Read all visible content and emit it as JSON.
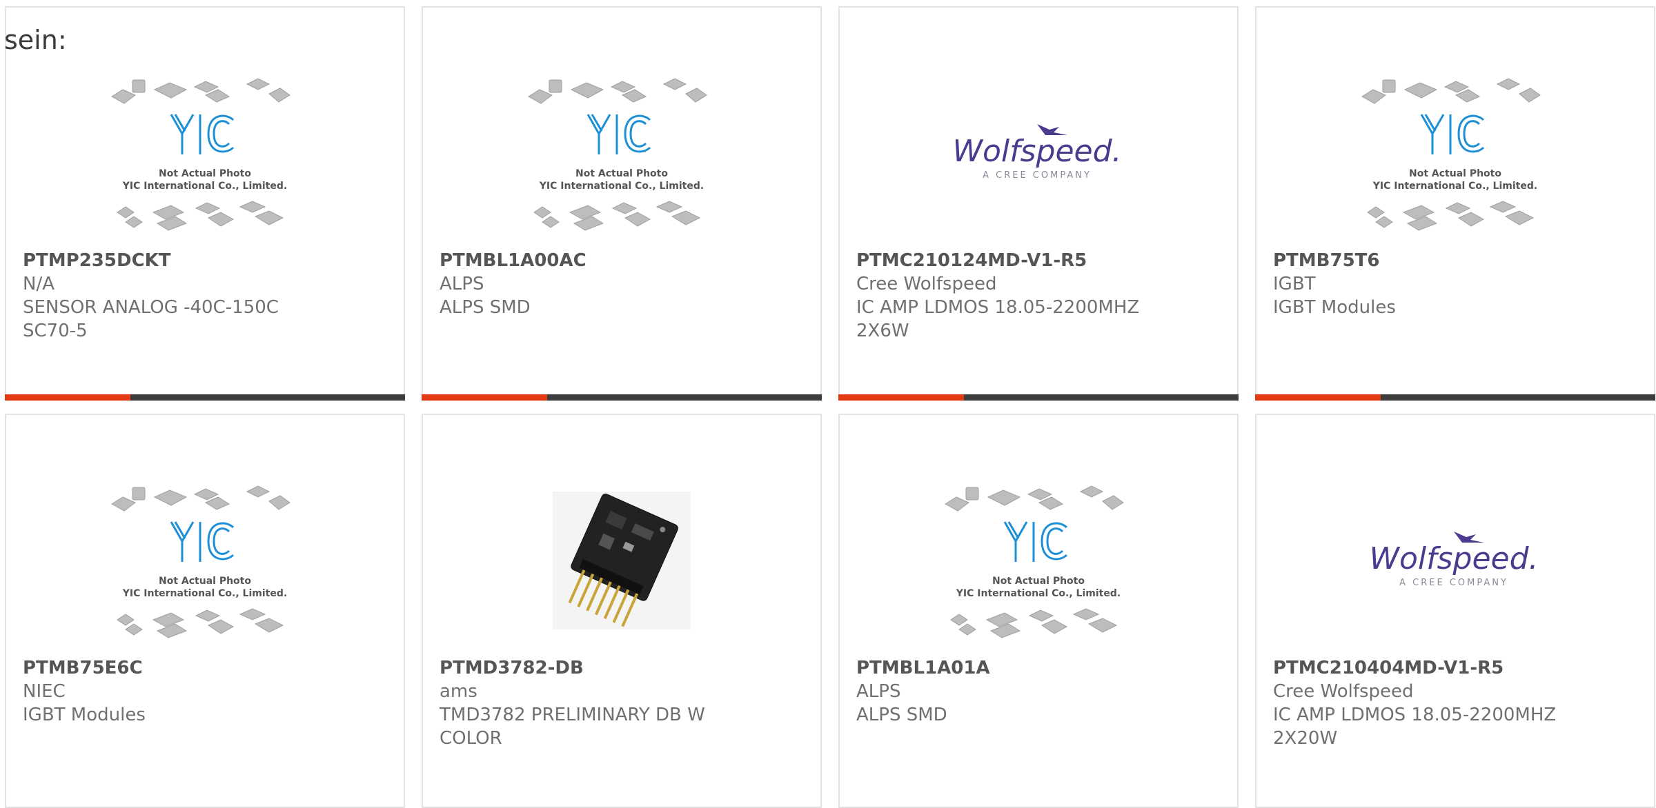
{
  "lead_text": "sein:",
  "colors": {
    "accent": "#e23b14",
    "bar": "#3d3d3d",
    "yic_blue": "#1d8fd6",
    "wolfspeed_purple": "#4b3a8e",
    "border": "#e3e3e3"
  },
  "placeholder": {
    "brand": "YIC",
    "line1": "Not Actual Photo",
    "line2": "YIC International Co., Limited."
  },
  "wolfspeed": {
    "brand": "Wolfspeed.",
    "tagline": "A CREE COMPANY"
  },
  "products": [
    {
      "part": "PTMP235DCKT",
      "manufacturer": "N/A",
      "desc1": "SENSOR ANALOG -40C-150C",
      "desc2": "SC70-5",
      "image": "yic-placeholder"
    },
    {
      "part": "PTMBL1A00AC",
      "manufacturer": "ALPS",
      "desc1": "ALPS SMD",
      "desc2": "",
      "image": "yic-placeholder"
    },
    {
      "part": "PTMC210124MD-V1-R5",
      "manufacturer": "Cree Wolfspeed",
      "desc1": "IC AMP LDMOS 18.05-2200MHZ",
      "desc2": "2X6W",
      "image": "wolfspeed-logo"
    },
    {
      "part": "PTMB75T6",
      "manufacturer": "IGBT",
      "desc1": "IGBT Modules",
      "desc2": "",
      "image": "yic-placeholder"
    },
    {
      "part": "PTMB75E6C",
      "manufacturer": "NIEC",
      "desc1": "IGBT Modules",
      "desc2": "",
      "image": "yic-placeholder"
    },
    {
      "part": "PTMD3782-DB",
      "manufacturer": "ams",
      "desc1": "TMD3782 PRELIMINARY DB W",
      "desc2": "COLOR",
      "image": "pcb-board-photo"
    },
    {
      "part": "PTMBL1A01A",
      "manufacturer": "ALPS",
      "desc1": "ALPS SMD",
      "desc2": "",
      "image": "yic-placeholder"
    },
    {
      "part": "PTMC210404MD-V1-R5",
      "manufacturer": "Cree Wolfspeed",
      "desc1": "IC AMP LDMOS 18.05-2200MHZ",
      "desc2": "2X20W",
      "image": "wolfspeed-logo"
    }
  ]
}
